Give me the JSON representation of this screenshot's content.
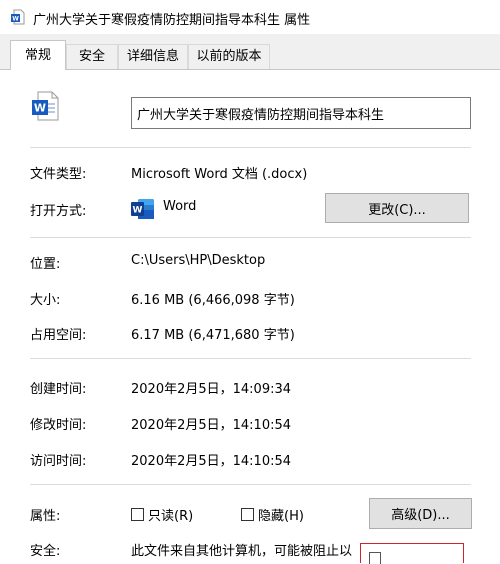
{
  "window": {
    "title": "广州大学关于寒假疫情防控期间指导本科生 属性"
  },
  "tabs": [
    {
      "label": "常规",
      "active": true
    },
    {
      "label": "安全",
      "active": false
    },
    {
      "label": "详细信息",
      "active": false
    },
    {
      "label": "以前的版本",
      "active": false
    }
  ],
  "general": {
    "file_name": "广州大学关于寒假疫情防控期间指导本科生",
    "file_type_label": "文件类型:",
    "file_type_value": "Microsoft Word 文档 (.docx)",
    "opens_with_label": "打开方式:",
    "opens_with_value": "Word",
    "change_button": "更改(C)...",
    "location_label": "位置:",
    "location_value": "C:\\Users\\HP\\Desktop",
    "size_label": "大小:",
    "size_value": "6.16 MB (6,466,098 字节)",
    "size_on_disk_label": "占用空间:",
    "size_on_disk_value": "6.17 MB (6,471,680 字节)",
    "created_label": "创建时间:",
    "created_value": "2020年2月5日，14:09:34",
    "modified_label": "修改时间:",
    "modified_value": "2020年2月5日，14:10:54",
    "accessed_label": "访问时间:",
    "accessed_value": "2020年2月5日，14:10:54",
    "attributes_label": "属性:",
    "readonly_label": "只读(R)",
    "readonly_checked": false,
    "hidden_label": "隐藏(H)",
    "hidden_checked": false,
    "advanced_button": "高级(D)...",
    "security_label": "安全:",
    "security_text": "此文件来自其他计算机，可能被阻止以"
  },
  "icons": {
    "app": "word-document-icon",
    "document": "word-document-icon",
    "opens_with": "word-app-icon"
  },
  "colors": {
    "word_blue": "#185abd",
    "highlight_red": "#d3212d"
  }
}
